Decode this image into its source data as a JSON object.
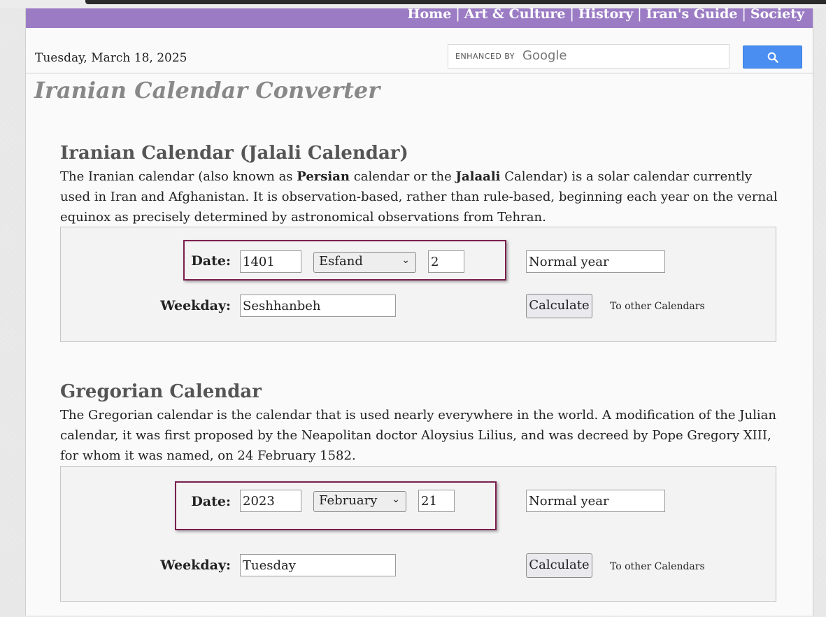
{
  "nav": {
    "items": [
      {
        "label": "Home"
      },
      {
        "label": "Art & Culture"
      },
      {
        "label": "History"
      },
      {
        "label": "Iran's Guide"
      },
      {
        "label": "Society"
      }
    ]
  },
  "header": {
    "date": "Tuesday, March 18, 2025",
    "search": {
      "enhanced_by": "ENHANCED BY",
      "brand": "Google",
      "button_icon": "search-icon"
    }
  },
  "page_title": "Iranian Calendar Converter",
  "iranian": {
    "title": "Iranian Calendar (Jalali Calendar)",
    "desc_1": "The Iranian calendar (also known as ",
    "desc_bold_1": "Persian",
    "desc_2": " calendar or the ",
    "desc_bold_2": "Jalaali",
    "desc_3": " Calendar) is a solar calendar currently used in Iran and Afghanistan. It is observation-based, rather than rule-based, beginning each year on the vernal equinox as precisely determined by astronomical observations from Tehran.",
    "date_label": "Date:",
    "year": "1401",
    "month": "Esfand",
    "day": "2",
    "year_type": "Normal year",
    "weekday_label": "Weekday:",
    "weekday": "Seshhanbeh",
    "calculate": "Calculate",
    "other": "To other Calendars"
  },
  "gregorian": {
    "title": "Gregorian Calendar",
    "desc": "The Gregorian calendar is the calendar that is used nearly everywhere in the world. A modification of the Julian calendar, it was first proposed by the Neapolitan doctor Aloysius Lilius, and was decreed by Pope Gregory XIII, for whom it was named, on 24 February 1582.",
    "date_label": "Date:",
    "year": "2023",
    "month": "February",
    "day": "21",
    "year_type": "Normal year",
    "weekday_label": "Weekday:",
    "weekday": "Tuesday",
    "calculate": "Calculate",
    "other": "To other Calendars"
  },
  "colors": {
    "nav_bg": "#9b7cc4",
    "highlight_border": "#7a1f4e",
    "search_button": "#4a8ef1"
  }
}
